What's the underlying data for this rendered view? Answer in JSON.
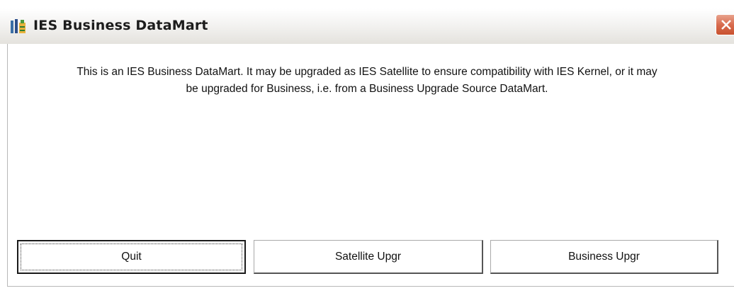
{
  "window": {
    "title": "IES Business DataMart",
    "icon": "datamart-app-icon",
    "close_icon": "close-icon"
  },
  "message": {
    "line1": "This is an IES Business DataMart. It may be upgraded as IES Satellite to ensure compatibility with IES Kernel, or it may",
    "line2": "be upgraded for Business, i.e. from a Business Upgrade Source DataMart."
  },
  "buttons": {
    "quit": "Quit",
    "satellite": "Satellite Upgr",
    "business": "Business Upgr"
  },
  "colors": {
    "close_button": "#d86b4e",
    "window_background": "#ffffff"
  }
}
